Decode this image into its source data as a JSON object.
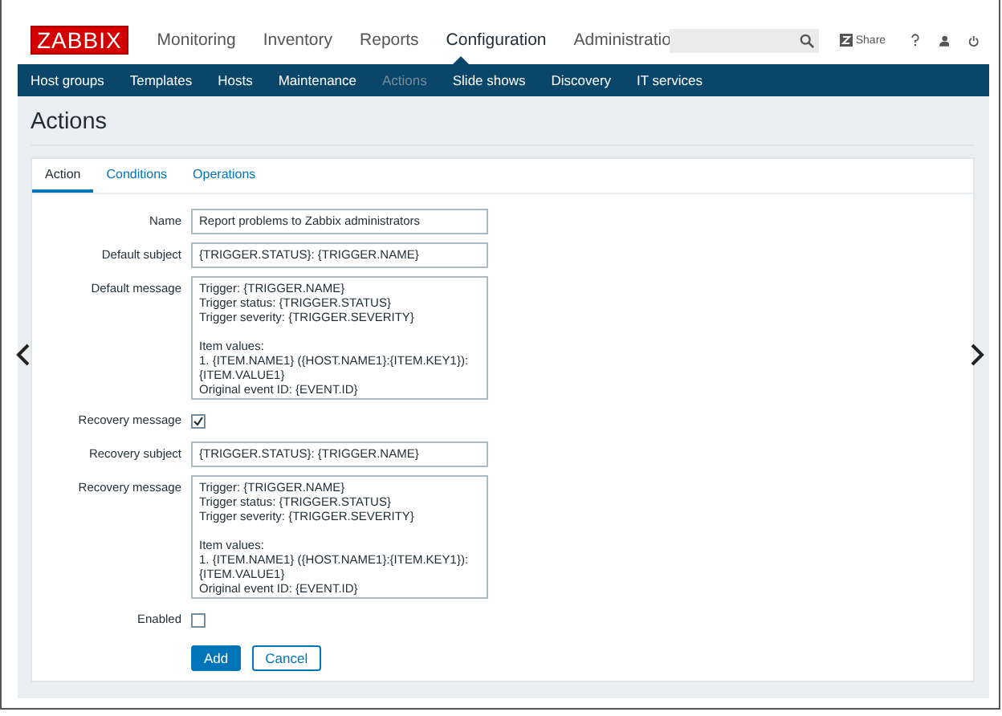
{
  "header": {
    "logo": "ZABBIX",
    "menu": [
      {
        "label": "Monitoring",
        "selected": false
      },
      {
        "label": "Inventory",
        "selected": false
      },
      {
        "label": "Reports",
        "selected": false
      },
      {
        "label": "Configuration",
        "selected": true
      },
      {
        "label": "Administratio",
        "selected": false
      }
    ],
    "share": "Share"
  },
  "submenu": [
    {
      "label": "Host groups",
      "selected": false
    },
    {
      "label": "Templates",
      "selected": false
    },
    {
      "label": "Hosts",
      "selected": false
    },
    {
      "label": "Maintenance",
      "selected": false
    },
    {
      "label": "Actions",
      "selected": true
    },
    {
      "label": "Slide shows",
      "selected": false
    },
    {
      "label": "Discovery",
      "selected": false
    },
    {
      "label": "IT services",
      "selected": false
    }
  ],
  "page_title": "Actions",
  "tabs": [
    {
      "label": "Action",
      "selected": true
    },
    {
      "label": "Conditions",
      "selected": false
    },
    {
      "label": "Operations",
      "selected": false
    }
  ],
  "form": [
    {
      "kind": "text",
      "label": "Name",
      "value": "Report problems to Zabbix administrators"
    },
    {
      "kind": "text",
      "label": "Default subject",
      "value": "{TRIGGER.STATUS}: {TRIGGER.NAME}"
    },
    {
      "kind": "textarea",
      "label": "Default message",
      "value": "Trigger: {TRIGGER.NAME}\nTrigger status: {TRIGGER.STATUS}\nTrigger severity: {TRIGGER.SEVERITY}\n\nItem values:\n1. {ITEM.NAME1} ({HOST.NAME1}:{ITEM.KEY1}):\n{ITEM.VALUE1}\nOriginal event ID: {EVENT.ID}"
    },
    {
      "kind": "checkbox",
      "label": "Recovery message",
      "checked": true
    },
    {
      "kind": "text",
      "label": "Recovery subject",
      "value": "{TRIGGER.STATUS}: {TRIGGER.NAME}"
    },
    {
      "kind": "textarea",
      "label": "Recovery message",
      "value": "Trigger: {TRIGGER.NAME}\nTrigger status: {TRIGGER.STATUS}\nTrigger severity: {TRIGGER.SEVERITY}\n\nItem values:\n1. {ITEM.NAME1} ({HOST.NAME1}:{ITEM.KEY1}):\n{ITEM.VALUE1}\nOriginal event ID: {EVENT.ID}"
    },
    {
      "kind": "checkbox",
      "label": "Enabled",
      "checked": false
    }
  ],
  "buttons": [
    {
      "label": "Add",
      "kind": "primary"
    },
    {
      "label": "Cancel",
      "kind": "secondary"
    }
  ]
}
